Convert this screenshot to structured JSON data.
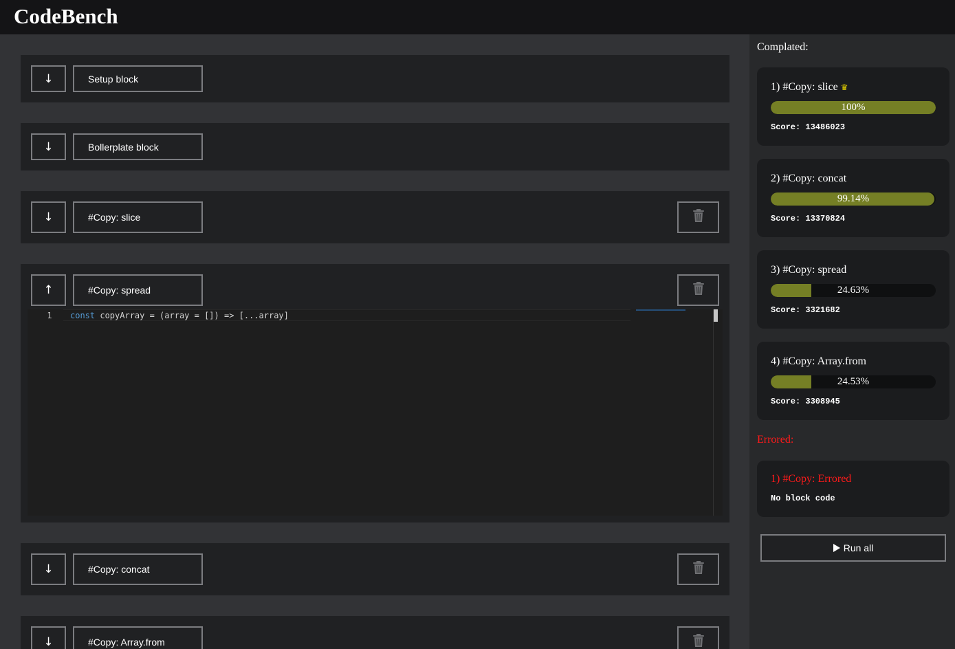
{
  "app": {
    "title": "CodeBench"
  },
  "blocks": [
    {
      "toggle": "↓",
      "name": "Setup block",
      "deletable": false
    },
    {
      "toggle": "↓",
      "name": "Bollerplate block",
      "deletable": false
    },
    {
      "toggle": "↓",
      "name": "#Copy: slice",
      "deletable": true
    },
    {
      "toggle": "↑",
      "name": "#Copy: spread",
      "deletable": true,
      "expanded": true,
      "code": {
        "line_number": "1",
        "keyword": "const",
        "rest": " copyArray = (array = []) => [...array]"
      }
    },
    {
      "toggle": "↓",
      "name": "#Copy: concat",
      "deletable": true
    },
    {
      "toggle": "↓",
      "name": "#Copy: Array.from",
      "deletable": true
    }
  ],
  "sidebar": {
    "completed_title": "Complated:",
    "results": [
      {
        "name": "1) #Copy: slice",
        "winner": true,
        "crown": "♛",
        "percent": 100,
        "percent_label": "100%",
        "score": "Score: 13486023"
      },
      {
        "name": "2) #Copy: concat",
        "winner": false,
        "percent": 99.14,
        "percent_label": "99.14%",
        "score": "Score: 13370824"
      },
      {
        "name": "3) #Copy: spread",
        "winner": false,
        "percent": 24.63,
        "percent_label": "24.63%",
        "score": "Score: 3321682"
      },
      {
        "name": "4) #Copy: Array.from",
        "winner": false,
        "percent": 24.53,
        "percent_label": "24.53%",
        "score": "Score: 3308945"
      }
    ],
    "errored_title": "Errored:",
    "errors": [
      {
        "name": "1) #Copy: Errored",
        "message": "No block code"
      }
    ],
    "run_all_label": "Run all"
  },
  "colors": {
    "bar_fill": "#757f25",
    "error": "#ff1a1a",
    "crown": "#e6d200",
    "keyword": "#569cd6"
  }
}
